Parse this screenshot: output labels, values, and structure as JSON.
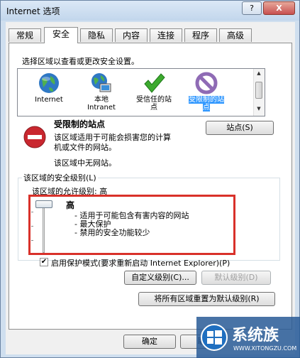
{
  "window": {
    "title": "Internet 选项",
    "help_label": "?",
    "close_label": "X"
  },
  "tabs": [
    {
      "label": "常规"
    },
    {
      "label": "安全"
    },
    {
      "label": "隐私"
    },
    {
      "label": "内容"
    },
    {
      "label": "连接"
    },
    {
      "label": "程序"
    },
    {
      "label": "高级"
    }
  ],
  "active_tab": "安全",
  "security": {
    "zone_prompt": "选择区域以查看或更改安全设置。",
    "zones": [
      {
        "label1": "Internet",
        "label2": "",
        "icon": "globe-icon"
      },
      {
        "label1": "本地",
        "label2": "Intranet",
        "icon": "local-intranet-icon"
      },
      {
        "label1": "受信任的站",
        "label2": "点",
        "icon": "green-check-icon"
      },
      {
        "label1": "受限制的站",
        "label2": "点",
        "icon": "restricted-icon"
      }
    ],
    "selected_zone": "受限制的站点",
    "zone_title": "受限制的站点",
    "zone_desc_line1": "该区域适用于可能会损害您的计算",
    "zone_desc_line2": "机或文件的网站。",
    "zone_no_sites": "该区域中无网站。",
    "sites_button": "站点(S)",
    "level_group_label": "该区域的安全级别(L)",
    "allowed_levels_label": "该区域的允许级别: 高",
    "level_name": "高",
    "level_bullets": [
      "- 适用于可能包含有害内容的网站",
      "- 最大保护",
      "- 禁用的安全功能较少"
    ],
    "protected_mode_label": "启用保护模式(要求重新启动 Internet Explorer)(P)",
    "protected_mode_checked": true,
    "custom_level_button": "自定义级别(C)...",
    "default_level_button": "默认级别(D)",
    "reset_all_button": "将所有区域重置为默认级别(R)"
  },
  "footer": {
    "ok_button": "确定",
    "cancel_button": "取"
  },
  "watermark": {
    "text": "系统族",
    "url": "WWW.XITONGZU.COM"
  }
}
